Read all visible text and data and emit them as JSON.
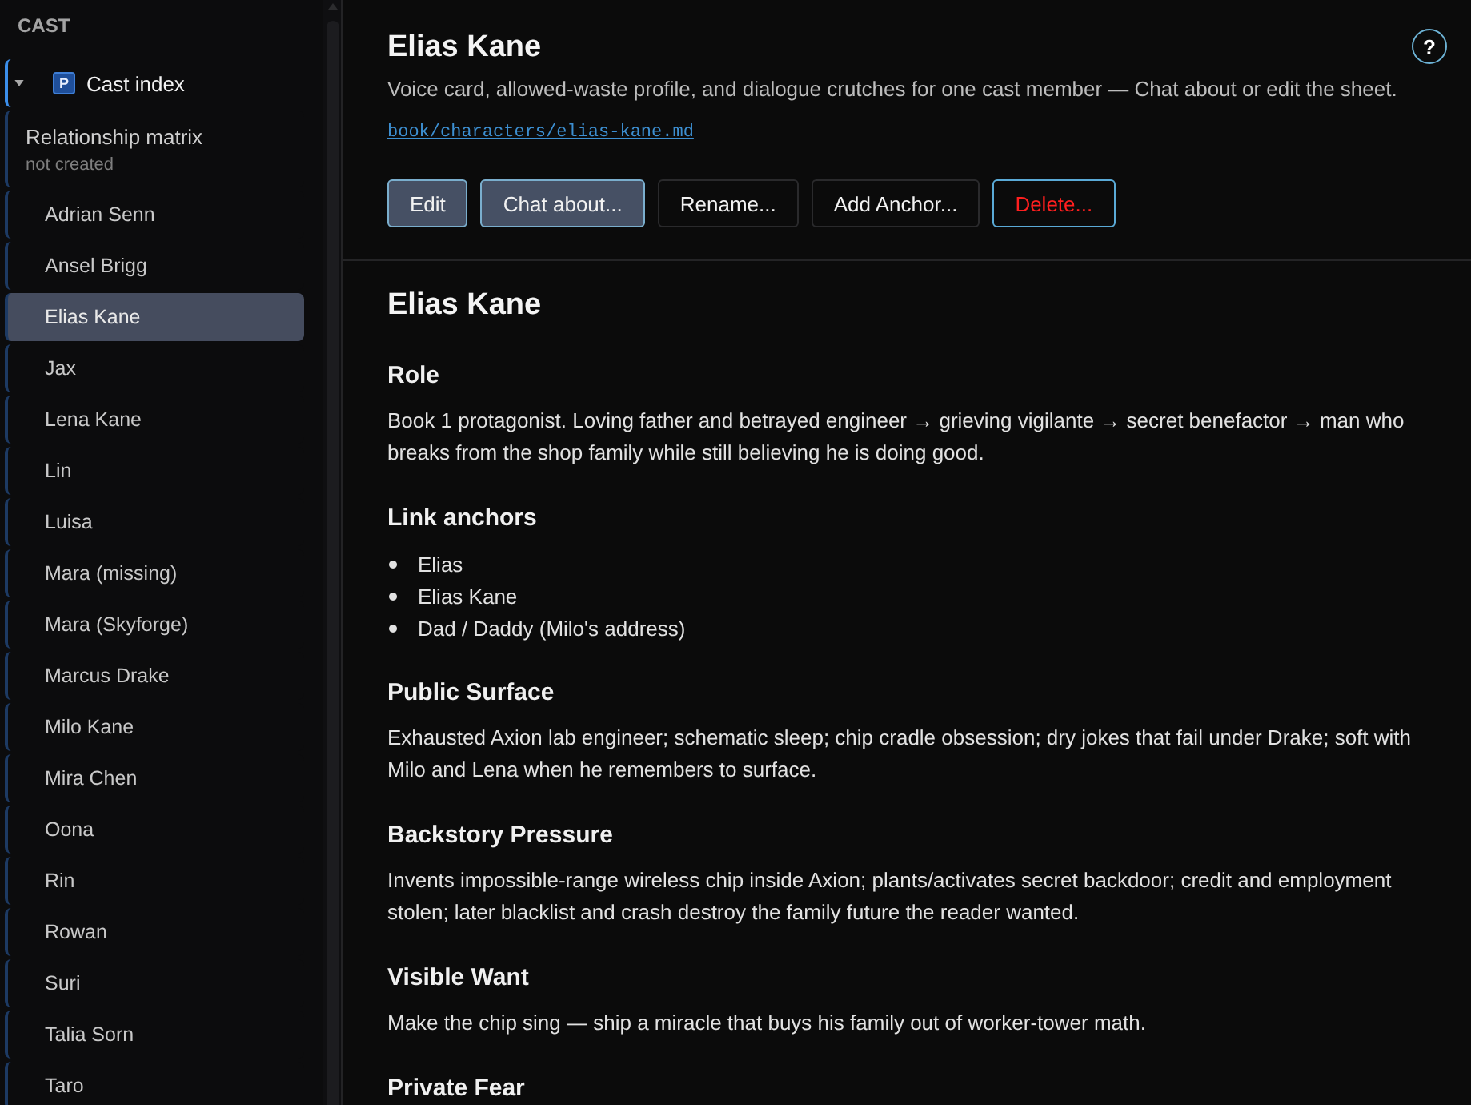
{
  "sidebar": {
    "title": "CAST",
    "index": {
      "label": "Cast index",
      "badge": "P",
      "expanded": true
    },
    "items": [
      {
        "kind": "doc",
        "label": "Relationship matrix",
        "note": "not created",
        "selected": false
      },
      {
        "kind": "character",
        "label": "Adrian Senn",
        "selected": false
      },
      {
        "kind": "character",
        "label": "Ansel Brigg",
        "selected": false
      },
      {
        "kind": "character",
        "label": "Elias Kane",
        "selected": true
      },
      {
        "kind": "character",
        "label": "Jax",
        "selected": false
      },
      {
        "kind": "character",
        "label": "Lena Kane",
        "selected": false
      },
      {
        "kind": "character",
        "label": "Lin",
        "selected": false
      },
      {
        "kind": "character",
        "label": "Luisa",
        "selected": false
      },
      {
        "kind": "character",
        "label": "Mara (missing)",
        "selected": false
      },
      {
        "kind": "character",
        "label": "Mara (Skyforge)",
        "selected": false
      },
      {
        "kind": "character",
        "label": "Marcus Drake",
        "selected": false
      },
      {
        "kind": "character",
        "label": "Milo Kane",
        "selected": false
      },
      {
        "kind": "character",
        "label": "Mira Chen",
        "selected": false
      },
      {
        "kind": "character",
        "label": "Oona",
        "selected": false
      },
      {
        "kind": "character",
        "label": "Rin",
        "selected": false
      },
      {
        "kind": "character",
        "label": "Rowan",
        "selected": false
      },
      {
        "kind": "character",
        "label": "Suri",
        "selected": false
      },
      {
        "kind": "character",
        "label": "Talia Sorn",
        "selected": false
      },
      {
        "kind": "character",
        "label": "Taro",
        "selected": false
      }
    ]
  },
  "header": {
    "title": "Elias Kane",
    "description": "Voice card, allowed-waste profile, and dialogue crutches for one cast member — Chat about or edit the sheet.",
    "path": "book/characters/elias-kane.md",
    "help": "?",
    "buttons": [
      {
        "label": "Edit",
        "kind": "filled"
      },
      {
        "label": "Chat about...",
        "kind": "filled"
      },
      {
        "label": "Rename...",
        "kind": "plain"
      },
      {
        "label": "Add Anchor...",
        "kind": "plain"
      },
      {
        "label": "Delete...",
        "kind": "danger"
      }
    ]
  },
  "document": {
    "title": "Elias Kane",
    "sections": [
      {
        "heading": "Role",
        "kind": "paragraph",
        "text": "Book 1 protagonist. Loving father and betrayed engineer → grieving vigilante → secret benefactor → man who breaks from the shop family while still believing he is doing good."
      },
      {
        "heading": "Link anchors",
        "kind": "list",
        "items": [
          "Elias",
          "Elias Kane",
          "Dad / Daddy (Milo's address)"
        ]
      },
      {
        "heading": "Public Surface",
        "kind": "paragraph",
        "text": "Exhausted Axion lab engineer; schematic sleep; chip cradle obsession; dry jokes that fail under Drake; soft with Milo and Lena when he remembers to surface."
      },
      {
        "heading": "Backstory Pressure",
        "kind": "paragraph",
        "text": "Invents impossible-range wireless chip inside Axion; plants/activates secret backdoor; credit and employment stolen; later blacklist and crash destroy the family future the reader wanted."
      },
      {
        "heading": "Visible Want",
        "kind": "paragraph",
        "text": "Make the chip sing — ship a miracle that buys his family out of worker-tower math."
      },
      {
        "heading": "Private Fear",
        "kind": "paragraph"
      }
    ]
  }
}
